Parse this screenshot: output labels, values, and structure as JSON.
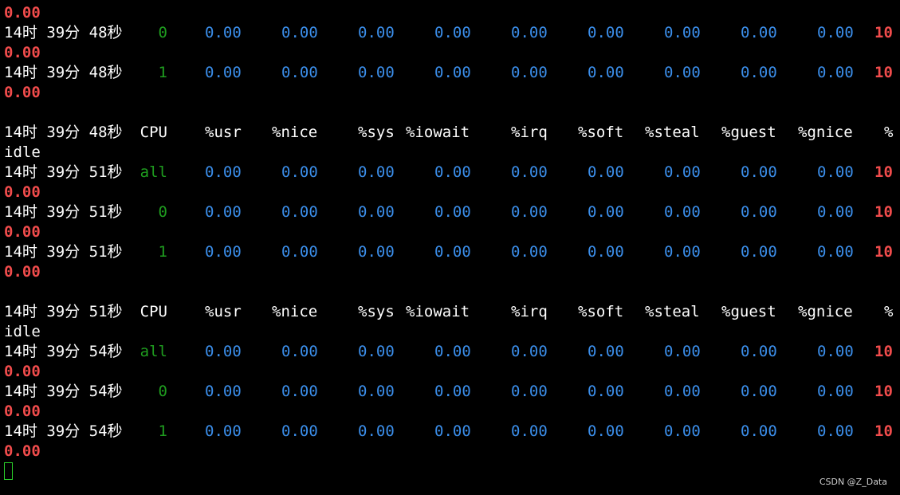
{
  "terminal": {
    "watermark": "CSDN @Z_Data",
    "header_labels": [
      "CPU",
      "%usr",
      "%nice",
      "%sys",
      "%iowait",
      "%irq",
      "%soft",
      "%steal",
      "%guest",
      "%gnice",
      "%"
    ],
    "header_wrap": "idle",
    "idle_wrap": "0.00",
    "idle_head": "10",
    "rows": [
      {
        "ts": "14时 39分 51秒",
        "cpu": "all",
        "values": [
          "0.00",
          "0.00",
          "0.00",
          "0.00",
          "0.00",
          "0.00",
          "0.00",
          "0.00",
          "0.00"
        ]
      },
      {
        "ts": "14时 39分 51秒",
        "cpu": "0",
        "values": [
          "0.00",
          "0.00",
          "0.00",
          "0.00",
          "0.00",
          "0.00",
          "0.00",
          "0.00",
          "0.00"
        ]
      },
      {
        "ts": "14时 39分 51秒",
        "cpu": "1",
        "values": [
          "0.00",
          "0.00",
          "0.00",
          "0.00",
          "0.00",
          "0.00",
          "0.00",
          "0.00",
          "0.00"
        ]
      },
      {
        "ts": "14时 39分 54秒",
        "cpu": "all",
        "values": [
          "0.00",
          "0.00",
          "0.00",
          "0.00",
          "0.00",
          "0.00",
          "0.00",
          "0.00",
          "0.00"
        ]
      },
      {
        "ts": "14时 39分 54秒",
        "cpu": "0",
        "values": [
          "0.00",
          "0.00",
          "0.00",
          "0.00",
          "0.00",
          "0.00",
          "0.00",
          "0.00",
          "0.00"
        ]
      },
      {
        "ts": "14时 39分 54秒",
        "cpu": "1",
        "values": [
          "0.00",
          "0.00",
          "0.00",
          "0.00",
          "0.00",
          "0.00",
          "0.00",
          "0.00",
          "0.00"
        ]
      },
      {
        "ts": "14时 39分 48秒",
        "cpu": "0",
        "values": [
          "0.00",
          "0.00",
          "0.00",
          "0.00",
          "0.00",
          "0.00",
          "0.00",
          "0.00",
          "0.00"
        ]
      },
      {
        "ts": "14时 39分 48秒",
        "cpu": "1",
        "values": [
          "0.00",
          "0.00",
          "0.00",
          "0.00",
          "0.00",
          "0.00",
          "0.00",
          "0.00",
          "0.00"
        ]
      }
    ],
    "header_ts": [
      "14时 39分 48秒",
      "14时 39分 51秒"
    ],
    "colors": {
      "background": "#000000",
      "value_blue": "#3b8eea",
      "cpu_green": "#1f9e1f",
      "idle_red": "#f14c4c",
      "text_white": "#ffffff",
      "cursor_green": "#2bd12b"
    }
  }
}
